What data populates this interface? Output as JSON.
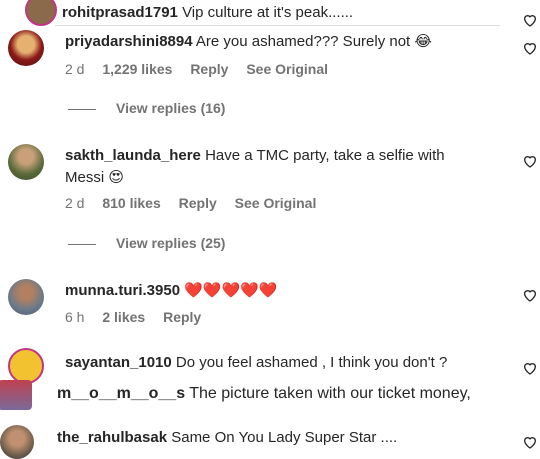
{
  "comments": [
    {
      "username": "rohitprasad1791",
      "text": "Vip culture at it's peak......"
    },
    {
      "username": "priyadarshini8894",
      "text": "Are you ashamed??? Surely not 😂",
      "time": "2 d",
      "likes": "1,229 likes",
      "reply": "Reply",
      "see_original": "See Original",
      "view_replies": "View replies (16)"
    },
    {
      "username": "sakth_launda_here",
      "text_line1": "Have a TMC party, take a selfie with",
      "text_line2": "Messi 😍",
      "time": "2 d",
      "likes": "810 likes",
      "reply": "Reply",
      "see_original": "See Original",
      "view_replies": "View replies (25)"
    },
    {
      "username": "munna.turi.3950",
      "text": "❤️❤️❤️❤️❤️",
      "time": "6 h",
      "likes": "2 likes",
      "reply": "Reply"
    },
    {
      "username": "sayantan_1010",
      "text": "Do you feel ashamed , I think you don't ?"
    },
    {
      "username": "m__o__m__o__s",
      "text": "The picture taken with our ticket money,"
    },
    {
      "username": "the_rahulbasak",
      "text": "Same On You Lady Super Star ...."
    }
  ]
}
